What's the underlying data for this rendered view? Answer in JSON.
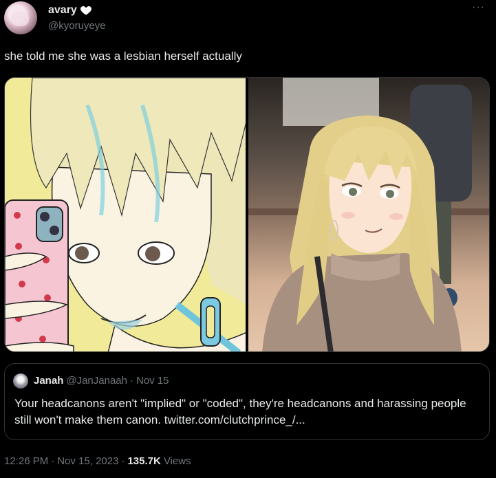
{
  "author": {
    "display_name": "avary",
    "handle": "@kyoruyeye",
    "badge_icon": "white-heart-icon"
  },
  "more_label": "···",
  "tweet_text": "she told me she was a lesbian herself actually",
  "quote": {
    "display_name": "Janah",
    "handle": "@JanJanaah",
    "separator": "·",
    "date": "Nov 15",
    "text": "Your headcanons aren't \"implied\" or \"coded\", they're headcanons and harassing people still won't make them canon. twitter.com/clutchprince_/..."
  },
  "meta": {
    "time": "12:26 PM",
    "separator": "·",
    "date": "Nov 15, 2023",
    "views_count": "135.7K",
    "views_label": "Views"
  },
  "colors": {
    "background": "#000000",
    "text": "#e7e9ea",
    "secondary": "#71767b",
    "border": "#2f3336"
  }
}
